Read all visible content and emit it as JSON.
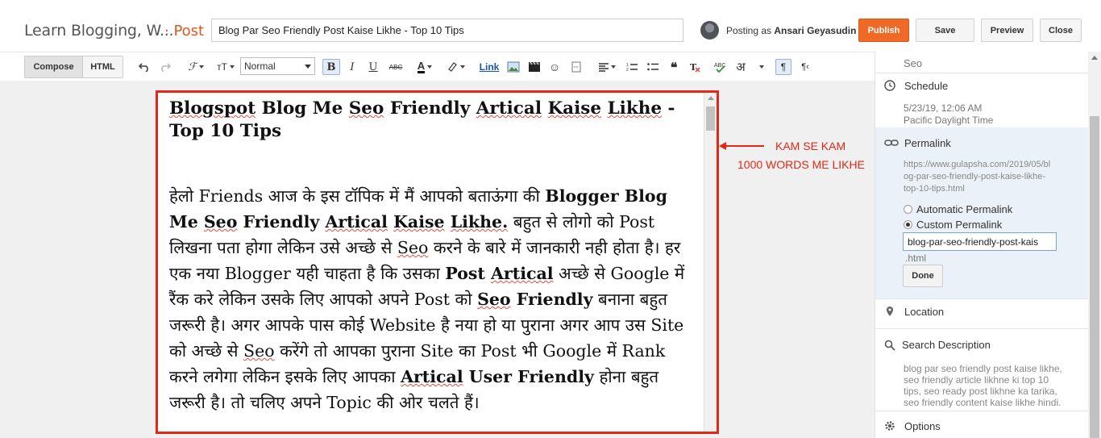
{
  "header": {
    "blog_title": "Learn Blogging, W...",
    "crumb": "· Post",
    "post_title": "Blog Par Seo Friendly Post Kaise Likhe - Top 10 Tips",
    "posting_as_prefix": "Posting as",
    "author": "Ansari Geyasudin",
    "publish": "Publish",
    "save": "Save",
    "preview": "Preview",
    "close": "Close"
  },
  "toolbar": {
    "compose": "Compose",
    "html": "HTML",
    "font_label": "Normal",
    "bold": "B",
    "italic": "I",
    "underline": "U",
    "strike": "ABC",
    "link": "Link",
    "hindi": "अ",
    "ltr": "¶",
    "rtl": "¶‹"
  },
  "editor": {
    "heading_parts": [
      "Blogspot",
      " Blog Me ",
      "Seo",
      " Friendly ",
      "Artical",
      " ",
      "Kaise",
      " ",
      "Likhe",
      " - Top 10 Tips"
    ],
    "body": {
      "p1a": "हेलो Friends आज के इस टॉपिक में मैं आपको बताऊंगा की ",
      "b1": "Blogger Blog Me ",
      "b1_seo": "Seo",
      "b1_friendly": " Friendly ",
      "b1_artical": "Artical",
      "b1_kaise": "Kaise",
      "b1_likhe": "Likhe.",
      "p1b": " बहुत से लोगो को Post लिखना पता होगा लेकिन उसे अच्छे से ",
      "seo2": "Seo",
      "p1c": " करने के बारे में जानकारी नही होता है। हर एक नया Blogger यही चाहता है कि उसका ",
      "b2_post": "Post",
      "b2_artical": "Artical",
      "p1d": " अच्छे से Google में रैंक करे लेकिन उसके लिए आपको अपने Post को ",
      "b3_seo": "Seo",
      "b3_friendly": " Friendly",
      "p1e": " बनाना बहुत जरूरी है। अगर आपके पास कोई Website है नया हो या पुराना अगर आप उस Site को अच्छे से ",
      "seo4": "Seo",
      "p1f": " करेंगे तो आपका पुराना Site का Post भी Google में Rank करने लगेगा लेकिन इसके लिए आपका ",
      "b4_artical": "Artical",
      "b4_rest": " User Friendly",
      "p1g": " होना बहुत जरूरी है। तो चलिए अपने Topic की ओर चलते हैं।"
    }
  },
  "annotation": {
    "line1": "KAM SE KAM",
    "line2": "1000 WORDS ME LIKHE"
  },
  "sidebar": {
    "labels_value": "Seo",
    "schedule": "Schedule",
    "schedule_date": "5/23/19, 12:06 AM",
    "schedule_tz": "Pacific Daylight Time",
    "permalink": "Permalink",
    "permalink_url_1": "https://www.gulapsha.com/2019/05/bl",
    "permalink_url_2": "og-par-seo-friendly-post-kaise-likhe-",
    "permalink_url_3": "top-10-tips.html",
    "auto_permalink": "Automatic Permalink",
    "custom_permalink": "Custom Permalink",
    "custom_value": "blog-par-seo-friendly-post-kais",
    "html_suffix": ".html",
    "done": "Done",
    "location": "Location",
    "search_description": "Search Description",
    "desc_1": "blog par seo friendly post kaise likhe,",
    "desc_2": "seo friendly article likhne ki top 10",
    "desc_3": "tips, seo ready post likhne ka tarika,",
    "desc_4": "seo friendly content kaise likhe hindi.",
    "options": "Options"
  },
  "colors": {
    "accent": "#f06a26",
    "annotation": "#e32818",
    "link": "#1a55b3"
  }
}
